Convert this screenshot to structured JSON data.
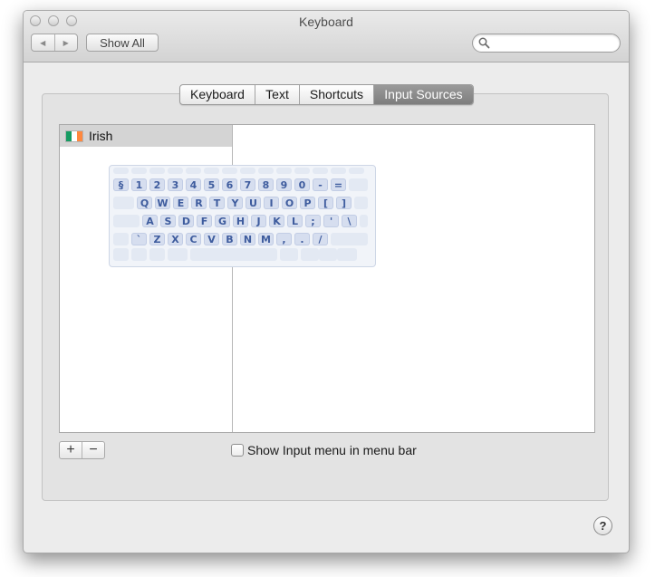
{
  "window": {
    "title": "Keyboard"
  },
  "toolbar": {
    "back_icon": "back-arrow-icon",
    "forward_icon": "forward-arrow-icon",
    "back_glyph": "◀",
    "forward_glyph": "▶",
    "show_all_label": "Show All",
    "search_placeholder": "",
    "search_value": ""
  },
  "tabs": [
    {
      "label": "Keyboard",
      "selected": false
    },
    {
      "label": "Text",
      "selected": false
    },
    {
      "label": "Shortcuts",
      "selected": false
    },
    {
      "label": "Input Sources",
      "selected": true
    }
  ],
  "input_sources": [
    {
      "label": "Irish",
      "flag": [
        "#169b62",
        "#ffffff",
        "#ff883e"
      ],
      "selected": true
    }
  ],
  "keyboard_preview": {
    "rows": [
      [
        "§",
        "1",
        "2",
        "3",
        "4",
        "5",
        "6",
        "7",
        "8",
        "9",
        "0",
        "-",
        "="
      ],
      [
        "Q",
        "W",
        "E",
        "R",
        "T",
        "Y",
        "U",
        "I",
        "O",
        "P",
        "[",
        "]"
      ],
      [
        "A",
        "S",
        "D",
        "F",
        "G",
        "H",
        "J",
        "K",
        "L",
        ";",
        "'",
        "\\"
      ],
      [
        "`",
        "Z",
        "X",
        "C",
        "V",
        "B",
        "N",
        "M",
        ",",
        ".",
        "/"
      ]
    ]
  },
  "buttons": {
    "add_label": "+",
    "remove_label": "−",
    "help_label": "?"
  },
  "checkbox": {
    "label": "Show Input menu in menu bar",
    "checked": false
  }
}
